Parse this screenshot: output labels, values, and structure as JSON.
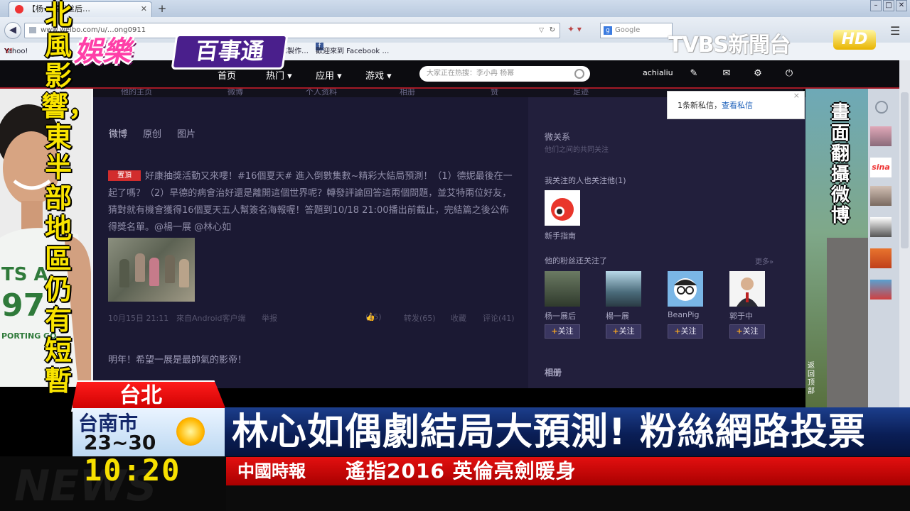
{
  "browser": {
    "tab_title": "【杨一展粉丝后…",
    "url": "www.weibo.com/u/…ong0911",
    "search_engine": "Google",
    "bookmarks": [
      "Yahoo!",
      "Yo",
      "…意製作…",
      "歡迎來到 Facebook …"
    ]
  },
  "weibo": {
    "nav": [
      "首页",
      "热门",
      "应用",
      "游戏"
    ],
    "search_placeholder": "大家正在热搜：李小冉 杨幂",
    "username": "achialiu",
    "subnav": [
      "他的主页",
      "微博",
      "个人资料",
      "相册",
      "赞",
      "足迹"
    ],
    "tabs": [
      "微博",
      "原创",
      "图片"
    ],
    "post": {
      "badge": "置頂",
      "text": "好康抽獎活動又來嘍！#16個夏天# 進入倒數集數~精彩大結局預測！（1）德妮最後在一起了嗎？（2）旱德的病會治好還是離開這個世界呢？轉發評論回答這兩個問題，並艾特兩位好友，猜對就有機會獲得16個夏天五人幫簽名海報喔！答題到10/18 21:00播出前截止，完結篇之後公佈得獎名單。@楊一展 @林心如",
      "date": "10月15日 21:11",
      "source": "來自Android客户端",
      "report": "举报",
      "likes": "(15)",
      "shares": "转发(65)",
      "fav": "收藏",
      "comments": "评论(41)"
    },
    "comment": "明年！希望一展是最帥氣的影帝！",
    "sidebar": {
      "relation_title": "微关系",
      "relation_sub": "他们之间的共同关注",
      "follow_also": "我关注的人也关注他(1)",
      "guide_name": "新手指南",
      "fans_follow": "他的粉丝还关注了",
      "more": "更多»",
      "users": [
        {
          "name": "杨一展后",
          "follow": "关注"
        },
        {
          "name": "楊一展",
          "follow": "关注"
        },
        {
          "name": "BeanPig",
          "follow": "关注"
        },
        {
          "name": "郭于中",
          "follow": "关注"
        }
      ],
      "photos_title": "相册"
    },
    "popup": {
      "text": "1条新私信，",
      "link": "查看私信",
      "close": "×"
    },
    "gotop": "返回顶部"
  },
  "tv": {
    "left_caption": "北風影響，東半部地區仍有短暫",
    "right_caption": "畫面翻攝微博",
    "show_logo_1": "娛樂",
    "show_logo_2": "百事通",
    "channel": "TVBS新聞台",
    "hd": "HD",
    "city": "台北",
    "weather_city": "台南市",
    "weather_temp": "23~30",
    "headline": "林心如偶劇結局大預測! 粉絲網路投票",
    "clock": "10:20",
    "news_source": "中國時報",
    "ticker": "遙指2016 英倫亮劍暖身",
    "watermark": "NEWS"
  },
  "colors": {
    "weibo_main": "#1b1933",
    "weibo_side": "#221f3c",
    "headline_blue": "#0a1e56",
    "ticker_red": "#c80000",
    "caption_yellow": "#f9e400"
  }
}
